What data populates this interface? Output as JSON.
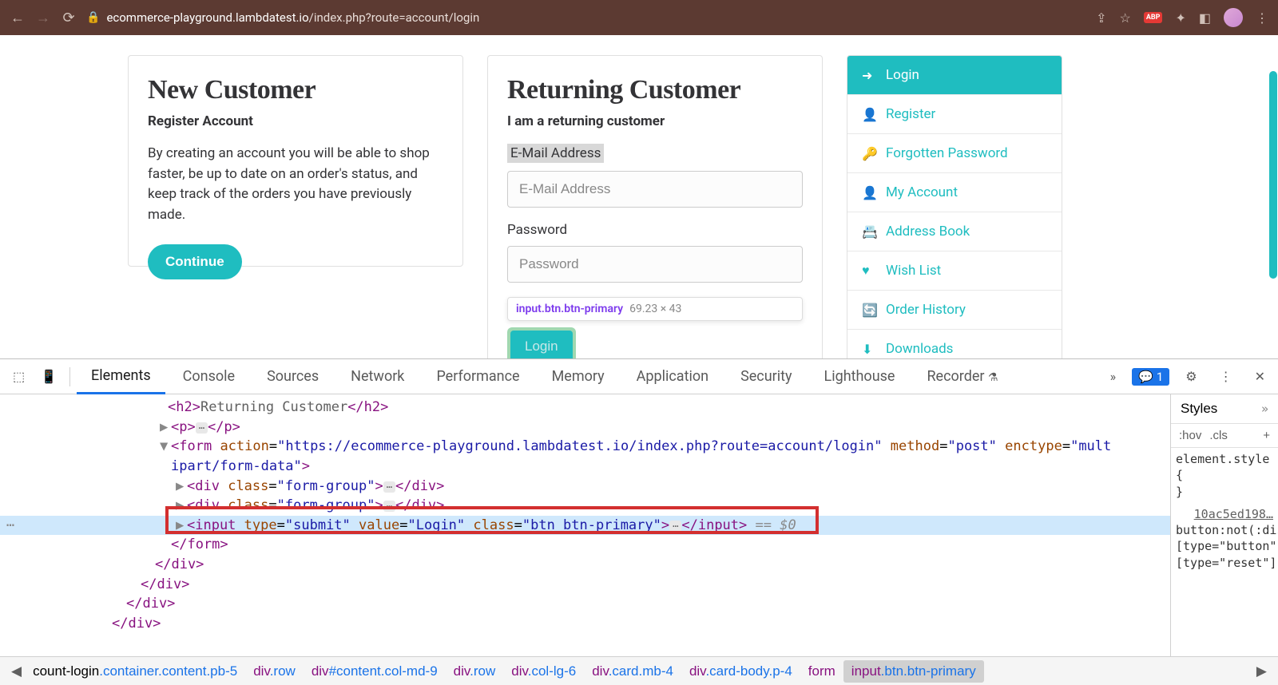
{
  "browser": {
    "url_domain": "ecommerce-playground.lambdatest.io",
    "url_path": "/index.php?route=account/login",
    "abp_label": "ABP"
  },
  "page": {
    "new_customer": {
      "title": "New Customer",
      "subtitle": "Register Account",
      "body": "By creating an account you will be able to shop faster, be up to date on an order's status, and keep track of the orders you have previously made.",
      "button": "Continue"
    },
    "returning": {
      "title": "Returning Customer",
      "subtitle": "I am a returning customer",
      "email_label": "E-Mail Address",
      "email_placeholder": "E-Mail Address",
      "password_label": "Password",
      "password_placeholder": "Password",
      "login_button": "Login"
    },
    "inspect_tooltip": {
      "selector": "input.btn.btn-primary",
      "dims": "69.23 × 43"
    },
    "sidebar": [
      {
        "icon": "↪",
        "label": "Login",
        "active": true
      },
      {
        "icon": "👤+",
        "label": "Register"
      },
      {
        "icon": "🔑",
        "label": "Forgotten Password"
      },
      {
        "icon": "👤",
        "label": "My Account"
      },
      {
        "icon": "📇",
        "label": "Address Book"
      },
      {
        "icon": "♥",
        "label": "Wish List"
      },
      {
        "icon": "🔄",
        "label": "Order History"
      },
      {
        "icon": "⬇",
        "label": "Downloads"
      }
    ]
  },
  "devtools": {
    "tabs": [
      "Elements",
      "Console",
      "Sources",
      "Network",
      "Performance",
      "Memory",
      "Application",
      "Security",
      "Lighthouse",
      "Recorder"
    ],
    "active_tab": "Elements",
    "issue_count": "1",
    "dom": {
      "line0_partial": "Returning Customer",
      "form_action": "https://ecommerce-playground.lambdatest.io/index.php?route=account/login",
      "form_method": "post",
      "form_enctype_partial": "mult",
      "form_enctype_rest": "ipart/form-data",
      "form_group_class": "form-group",
      "input_type": "submit",
      "input_value": "Login",
      "input_class": "btn btn-primary",
      "var_suffix": " == $0"
    },
    "styles": {
      "title": "Styles",
      "hov": ":hov",
      "cls": ".cls",
      "element_style": "element.style {\n}",
      "source_link": "10ac5ed198…",
      "rule_body": "button:not(:disabled),\n[type=\"button\"]:not(:disabled),\n[type=\"reset\"]:not(:disabl"
    },
    "breadcrumb": [
      {
        "partial": "count-login",
        "classes": ".container.content.pb-5"
      },
      {
        "tag": "div",
        "classes": ".row"
      },
      {
        "tag": "div",
        "id": "#content",
        "classes": ".col-md-9"
      },
      {
        "tag": "div",
        "classes": ".row"
      },
      {
        "tag": "div",
        "classes": ".col-lg-6"
      },
      {
        "tag": "div",
        "classes": ".card.mb-4"
      },
      {
        "tag": "div",
        "classes": ".card-body.p-4"
      },
      {
        "tag": "form",
        "classes": ""
      },
      {
        "tag": "input",
        "classes": ".btn.btn-primary",
        "selected": true
      }
    ]
  }
}
